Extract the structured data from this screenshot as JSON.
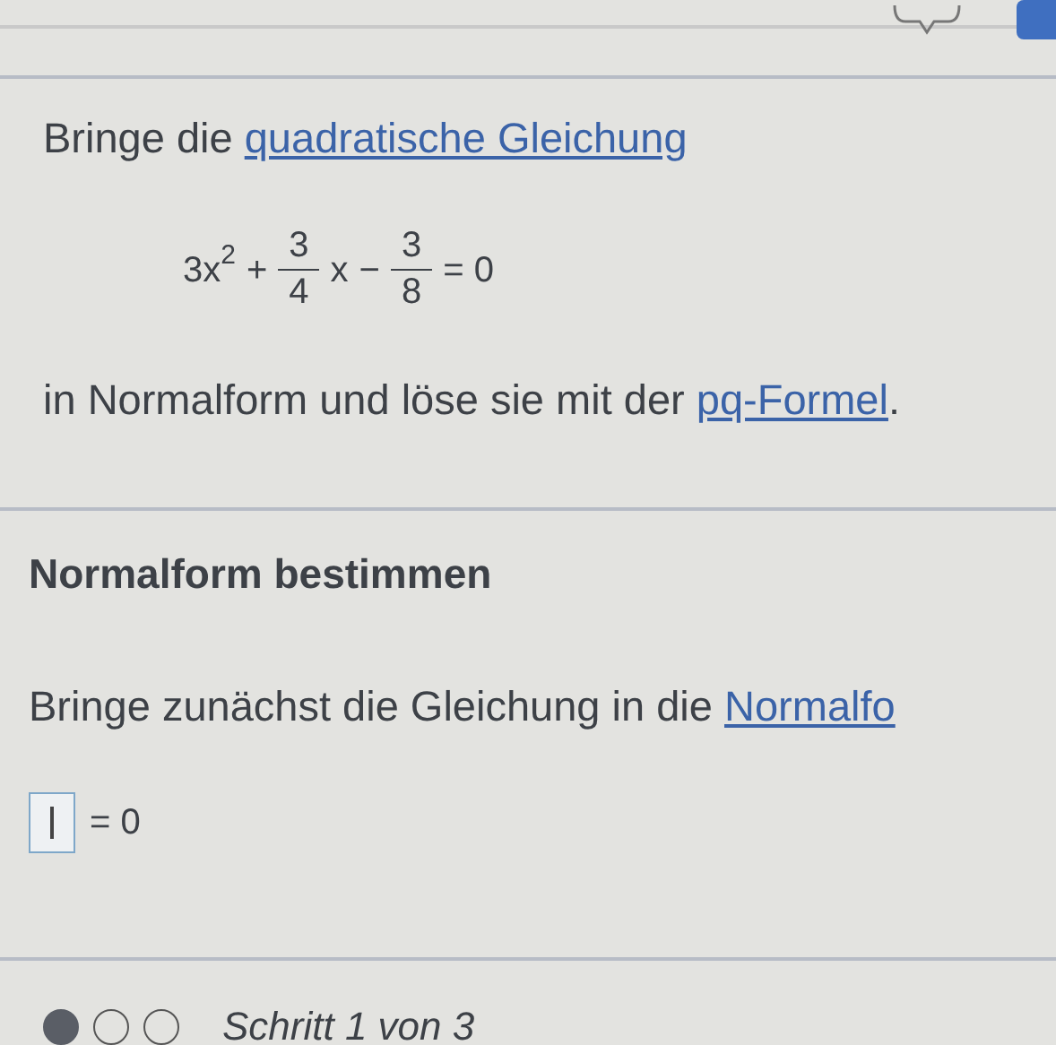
{
  "task": {
    "intro": [
      {
        "kind": "text",
        "text": "Bringe die "
      },
      {
        "kind": "link",
        "text": "quadratische Gleichung"
      }
    ],
    "equation": [
      {
        "kind": "text",
        "text": "3x"
      },
      {
        "kind": "sup",
        "text": "2"
      },
      {
        "kind": "op",
        "text": "+"
      },
      {
        "kind": "frac",
        "num": "3",
        "den": "4"
      },
      {
        "kind": "text",
        "text": "x"
      },
      {
        "kind": "op",
        "text": "−"
      },
      {
        "kind": "frac",
        "num": "3",
        "den": "8"
      },
      {
        "kind": "op",
        "text": "= 0"
      }
    ],
    "outro": [
      {
        "kind": "text",
        "text": "in Normalform und löse sie mit der "
      },
      {
        "kind": "link",
        "text": "pq-Formel"
      },
      {
        "kind": "text",
        "text": "."
      }
    ]
  },
  "step": {
    "heading": "Normalform bestimmen",
    "instruction": [
      {
        "kind": "text",
        "text": "Bringe zunächst die Gleichung in die "
      },
      {
        "kind": "link",
        "text": "Normalfo"
      }
    ],
    "answer": {
      "focused": true,
      "rhs": "= 0"
    }
  },
  "progress": {
    "dots": [
      {
        "done": true
      },
      {
        "done": false
      },
      {
        "done": false
      }
    ],
    "label": "Schritt 1 von 3"
  }
}
